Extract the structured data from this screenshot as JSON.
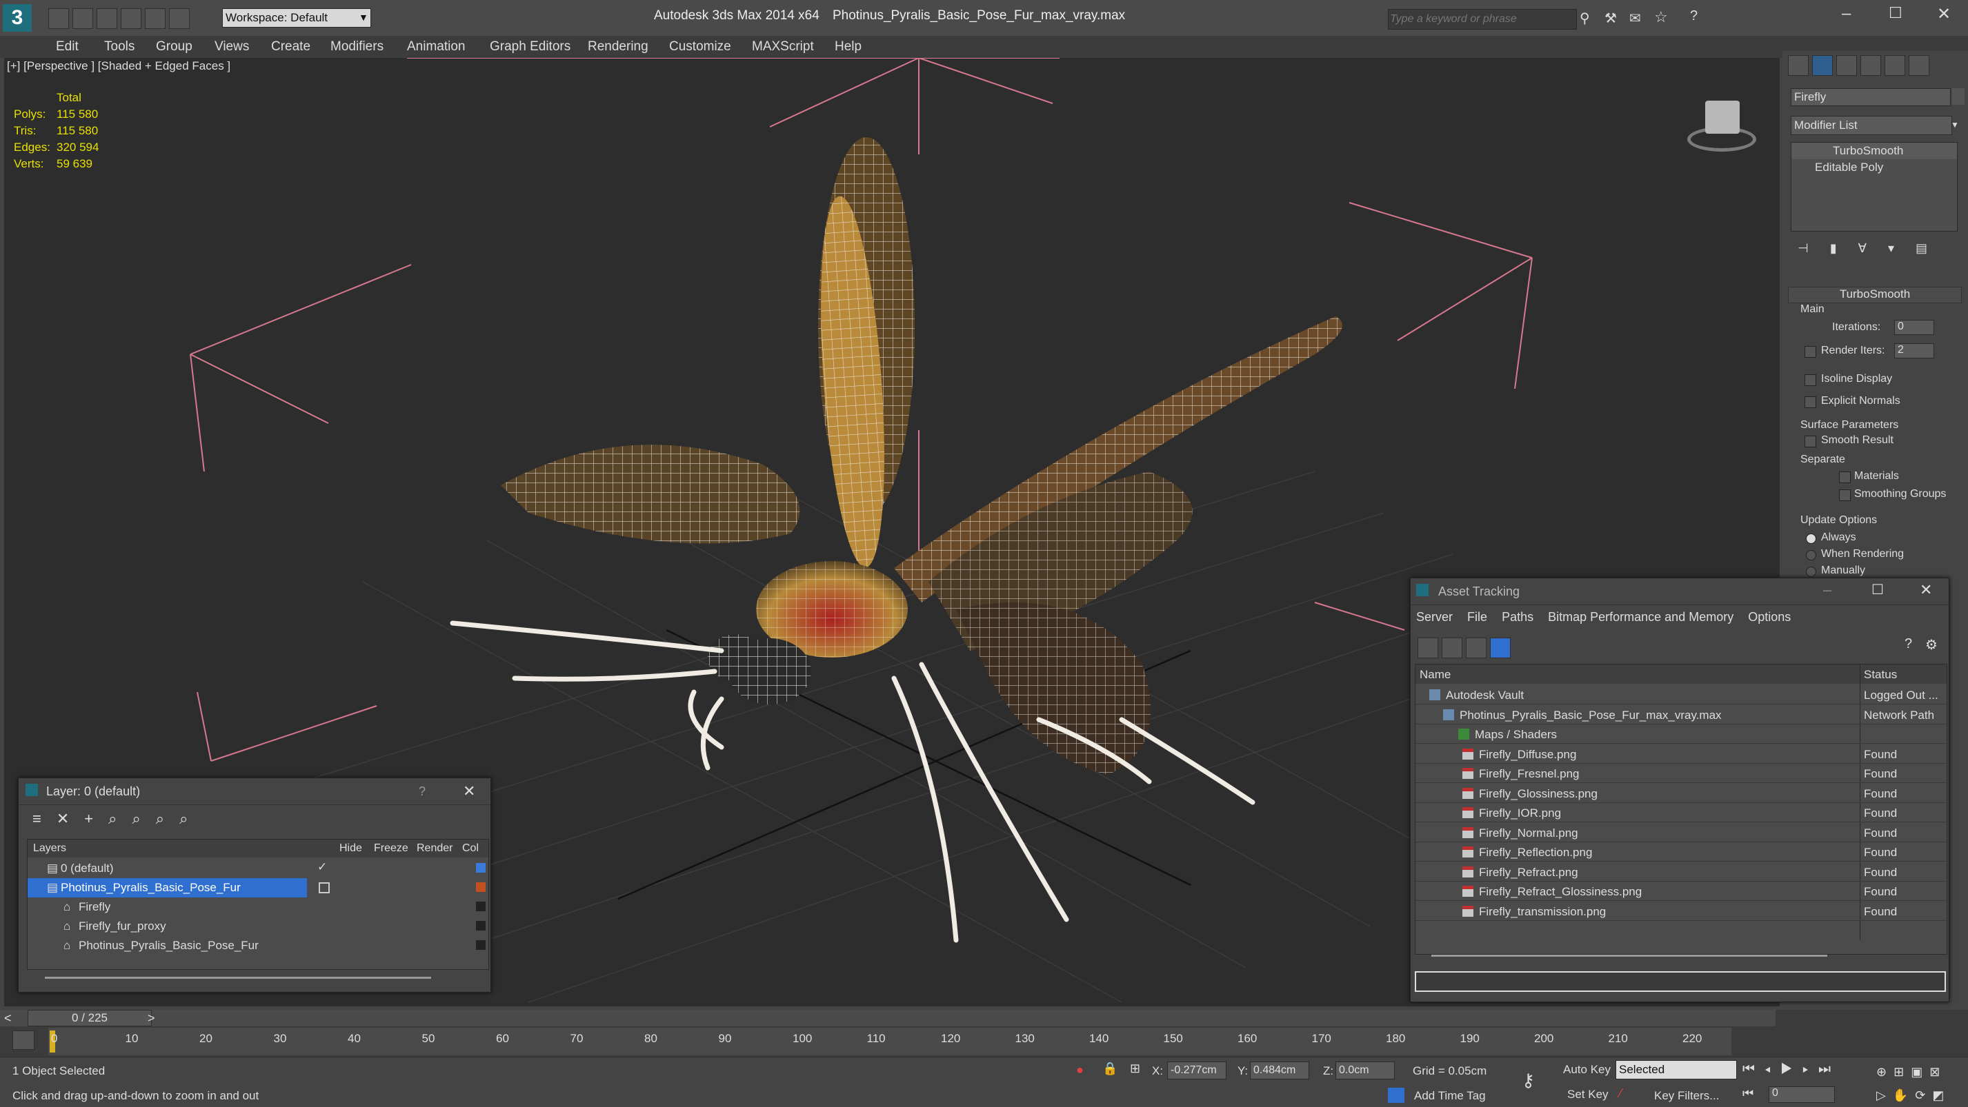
{
  "app": {
    "title": "Autodesk 3ds Max  2014 x64",
    "file": "Photinus_Pyralis_Basic_Pose_Fur_max_vray.max",
    "workspace": "Workspace: Default",
    "search_placeholder": "Type a keyword or phrase"
  },
  "menu": [
    "Edit",
    "Tools",
    "Group",
    "Views",
    "Create",
    "Modifiers",
    "Animation",
    "Graph Editors",
    "Rendering",
    "Customize",
    "MAXScript",
    "Help"
  ],
  "viewport": {
    "label": "[+] [Perspective ] [Shaded + Edged Faces ]",
    "stats": {
      "header": "Total",
      "rows": [
        {
          "k": "Polys:",
          "v": "115 580"
        },
        {
          "k": "Tris:",
          "v": "115 580"
        },
        {
          "k": "Edges:",
          "v": "320 594"
        },
        {
          "k": "Verts:",
          "v": "59 639"
        }
      ]
    }
  },
  "command_panel": {
    "object_name": "Firefly",
    "modifier_list": "Modifier List",
    "stack": [
      "TurboSmooth",
      "Editable Poly"
    ],
    "rollout_title": "TurboSmooth",
    "main_label": "Main",
    "iterations_label": "Iterations:",
    "iterations_value": "0",
    "render_iters_label": "Render Iters:",
    "render_iters_value": "2",
    "isoline": "Isoline Display",
    "explicit_normals": "Explicit Normals",
    "surface_params": "Surface Parameters",
    "smooth_result": "Smooth Result",
    "separate": "Separate",
    "materials": "Materials",
    "smoothing_groups": "Smoothing Groups",
    "update_options": "Update Options",
    "always": "Always",
    "when_rendering": "When Rendering",
    "manually": "Manually"
  },
  "layer_window": {
    "title": "Layer: 0 (default)",
    "help": "?",
    "columns": [
      "Layers",
      "Hide",
      "Freeze",
      "Render",
      "Col"
    ],
    "rows": [
      {
        "name": "0 (default)",
        "indent": 0,
        "color": "#3a7ad8"
      },
      {
        "name": "Photinus_Pyralis_Basic_Pose_Fur",
        "indent": 0,
        "color": "#c05020",
        "selected": true
      },
      {
        "name": "Firefly",
        "indent": 1,
        "color": "#222222"
      },
      {
        "name": "Firefly_fur_proxy",
        "indent": 1,
        "color": "#222222"
      },
      {
        "name": "Photinus_Pyralis_Basic_Pose_Fur",
        "indent": 1,
        "color": "#222222"
      }
    ]
  },
  "asset_window": {
    "title": "Asset Tracking",
    "menu": [
      "Server",
      "File",
      "Paths",
      "Bitmap Performance and Memory",
      "Options"
    ],
    "columns": [
      "Name",
      "Status"
    ],
    "rows": [
      {
        "name": "Autodesk Vault",
        "status": "Logged Out ...",
        "level": 0
      },
      {
        "name": "Photinus_Pyralis_Basic_Pose_Fur_max_vray.max",
        "status": "Network Path",
        "level": 1
      },
      {
        "name": "Maps / Shaders",
        "status": "",
        "level": 2
      },
      {
        "name": "Firefly_Diffuse.png",
        "status": "Found",
        "level": 3
      },
      {
        "name": "Firefly_Fresnel.png",
        "status": "Found",
        "level": 3
      },
      {
        "name": "Firefly_Glossiness.png",
        "status": "Found",
        "level": 3
      },
      {
        "name": "Firefly_IOR.png",
        "status": "Found",
        "level": 3
      },
      {
        "name": "Firefly_Normal.png",
        "status": "Found",
        "level": 3
      },
      {
        "name": "Firefly_Reflection.png",
        "status": "Found",
        "level": 3
      },
      {
        "name": "Firefly_Refract.png",
        "status": "Found",
        "level": 3
      },
      {
        "name": "Firefly_Refract_Glossiness.png",
        "status": "Found",
        "level": 3
      },
      {
        "name": "Firefly_transmission.png",
        "status": "Found",
        "level": 3
      }
    ]
  },
  "timeline": {
    "frame": "0 / 225",
    "ticks": [
      "0",
      "10",
      "20",
      "30",
      "40",
      "50",
      "60",
      "70",
      "80",
      "90",
      "100",
      "110",
      "120",
      "130",
      "140",
      "150",
      "160",
      "170",
      "180",
      "190",
      "200",
      "210",
      "220"
    ]
  },
  "status": {
    "selected": "1 Object Selected",
    "hint": "Click and drag up-and-down to zoom in and out",
    "x_label": "X:",
    "x_value": "-0.277cm",
    "y_label": "Y:",
    "y_value": "0.484cm",
    "z_label": "Z:",
    "z_value": "0.0cm",
    "grid": "Grid = 0.05cm",
    "add_time_tag": "Add Time Tag",
    "auto_key": "Auto Key",
    "set_key": "Set Key",
    "selected_dropdown": "Selected",
    "key_filters": "Key Filters...",
    "frame_field": "0"
  }
}
